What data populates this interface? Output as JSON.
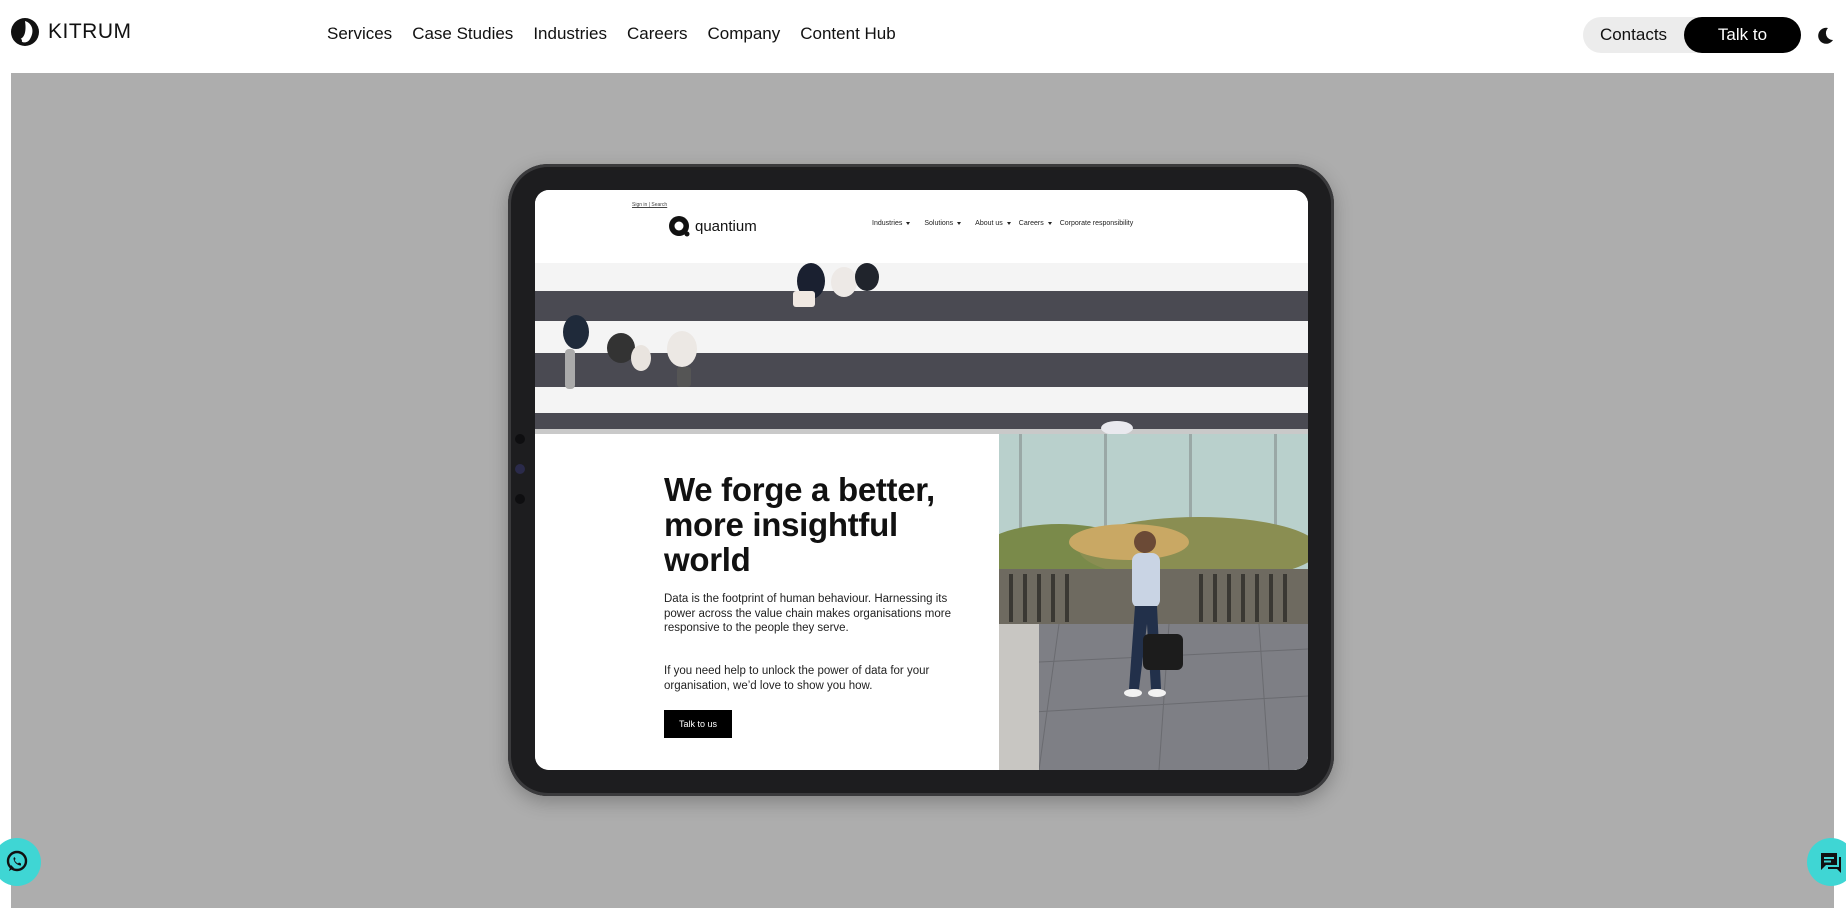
{
  "header": {
    "brand": "KITRUM",
    "nav": [
      "Services",
      "Case Studies",
      "Industries",
      "Careers",
      "Company",
      "Content Hub"
    ],
    "contacts_label": "Contacts",
    "cta_label": "Talk to CEO"
  },
  "tablet_site": {
    "top_links": "Sign in | Search",
    "brand": "quantium",
    "nav": [
      "Industries",
      "Solutions",
      "About us",
      "Careers",
      "Corporate responsibility"
    ],
    "headline": "We forge a better, more insightful world",
    "paragraph1": "Data is the footprint of human behaviour. Harnessing its power across the value chain makes organisations more responsive to the people they serve.",
    "paragraph2": "If you need help to unlock the power of data for your organisation, we’d love to show you how.",
    "button": "Talk to us"
  },
  "colors": {
    "accent": "#3fd6d4",
    "hero_bg": "#adadad",
    "cta_bg": "#000000"
  },
  "icons": {
    "theme_toggle": "moon-icon",
    "left_floating": "whatsapp-icon",
    "right_floating": "chat-icon"
  }
}
